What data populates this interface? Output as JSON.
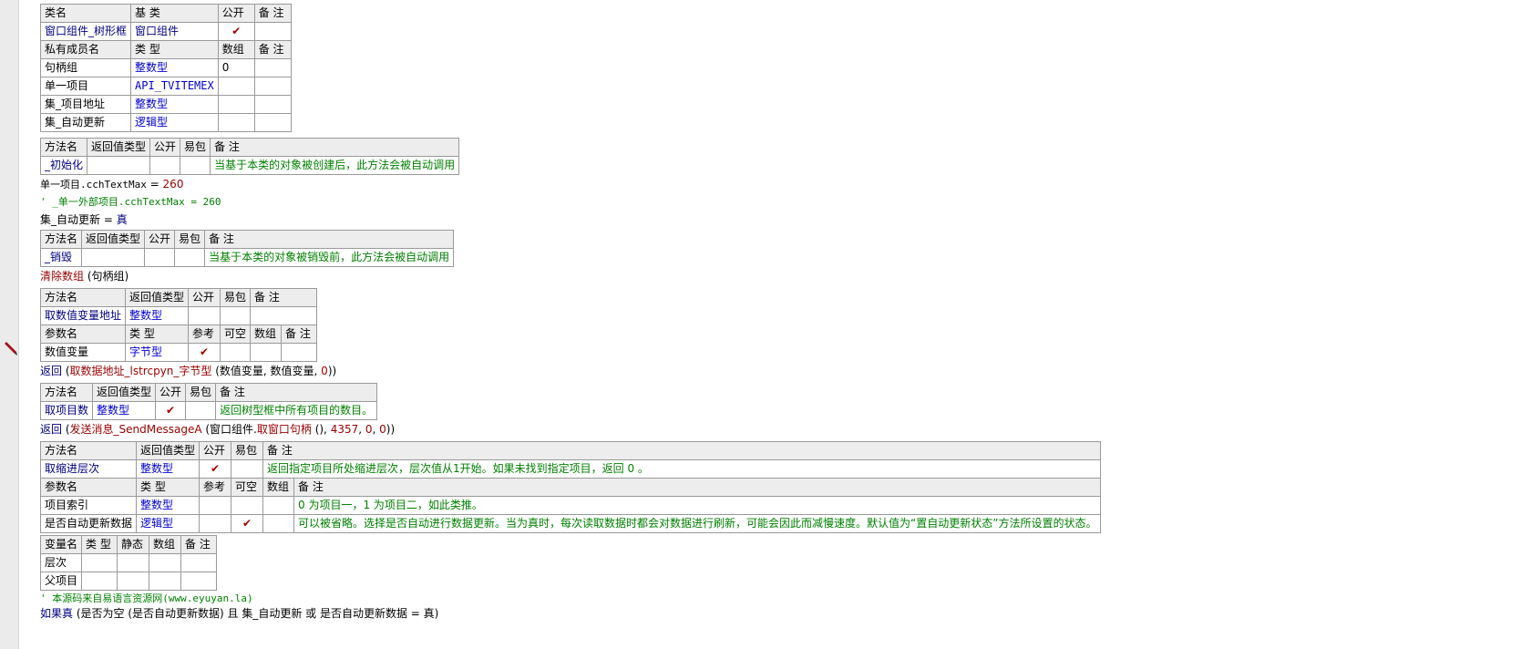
{
  "class_table": {
    "header": [
      "类名",
      "基 类",
      "公开",
      "备 注"
    ],
    "row": {
      "name": "窗口组件_树形框",
      "base": "窗口组件",
      "public": "✔",
      "note": ""
    },
    "member_header": [
      "私有成员名",
      "类 型",
      "数组",
      "备 注"
    ],
    "members": [
      {
        "name": "句柄组",
        "type": "整数型",
        "array": "0",
        "note": ""
      },
      {
        "name": "单一项目",
        "type": "API_TVITEMEX",
        "array": "",
        "note": ""
      },
      {
        "name": "集_项目地址",
        "type": "整数型",
        "array": "",
        "note": ""
      },
      {
        "name": "集_自动更新",
        "type": "逻辑型",
        "array": "",
        "note": ""
      }
    ]
  },
  "method_header_full": [
    "方法名",
    "返回值类型",
    "公开",
    "易包",
    "备 注"
  ],
  "param_header": [
    "参数名",
    "类 型",
    "参考",
    "可空",
    "数组",
    "备 注"
  ],
  "m_init": {
    "name": "_初始化",
    "ret": "",
    "public": "",
    "easy": "",
    "note": "当基于本类的对象被创建后，此方法会被自动调用"
  },
  "code_init": {
    "l1_a": "单一项目.cchTextMax",
    "l1_b": " = ",
    "l1_c": "260",
    "l2": "' _单一外部项目.cchTextMax = 260",
    "l3_a": "集_自动更新",
    "l3_b": " = ",
    "l3_c": "真"
  },
  "m_destroy": {
    "name": "_销毁",
    "ret": "",
    "public": "",
    "easy": "",
    "note": "当基于本类的对象被销毁前，此方法会被自动调用"
  },
  "code_destroy": {
    "fn": "清除数组",
    "args": " (句柄组)"
  },
  "m_getaddr": {
    "name": "取数值变量地址",
    "ret": "整数型",
    "public": "",
    "easy": "",
    "note": ""
  },
  "m_getaddr_params": [
    {
      "name": "数值变量",
      "type": "字节型",
      "ref": "✔",
      "nullable": "",
      "array": "",
      "note": ""
    }
  ],
  "code_getaddr": {
    "kw": "返回",
    "a": " (",
    "fn": "取数据地址_lstrcpyn_字节型",
    "b": " (数值变量, 数值变量, ",
    "n": "0",
    "c": "))"
  },
  "m_count": {
    "name": "取项目数",
    "ret": "整数型",
    "public": "✔",
    "easy": "",
    "note": "返回树型框中所有项目的数目。"
  },
  "code_count": {
    "kw": "返回",
    "a": " (",
    "fn": "发送消息_SendMessageA",
    "b": " (窗口组件.",
    "fn2": "取窗口句柄",
    "c": " (), ",
    "n1": "4357",
    "d": ", ",
    "n2": "0",
    "e": ", ",
    "n3": "0",
    "f": "))"
  },
  "m_level": {
    "name": "取缩进层次",
    "ret": "整数型",
    "public": "✔",
    "easy": "",
    "note": "返回指定项目所处缩进层次，层次值从1开始。如果未找到指定项目，返回 0 。"
  },
  "m_level_params": [
    {
      "name": "项目索引",
      "type": "整数型",
      "ref": "",
      "nullable": "",
      "array": "",
      "note": "0 为项目一，1 为项目二，如此类推。"
    },
    {
      "name": "是否自动更新数据",
      "type": "逻辑型",
      "ref": "",
      "nullable": "✔",
      "array": "",
      "note": "可以被省略。选择是否自动进行数据更新。当为真时，每次读取数据时都会对数据进行刷新，可能会因此而减慢速度。默认值为“置自动更新状态”方法所设置的状态。"
    }
  ],
  "var_table": {
    "header": [
      "变量名",
      "类 型",
      "静态",
      "数组",
      "备 注"
    ],
    "rows": [
      {
        "name": "层次",
        "type": "",
        "static": "",
        "array": "",
        "note": ""
      },
      {
        "name": "父项目",
        "type": "",
        "static": "",
        "array": "",
        "note": ""
      }
    ]
  },
  "code_tail": {
    "comment": "' 本源码来自易语言资源网(www.eyuyan.la)",
    "last_kw": "如果真",
    "last_rest": " (是否为空 (是否自动更新数据) 且 集_自动更新 或 是否自动更新数据 = 真)"
  }
}
